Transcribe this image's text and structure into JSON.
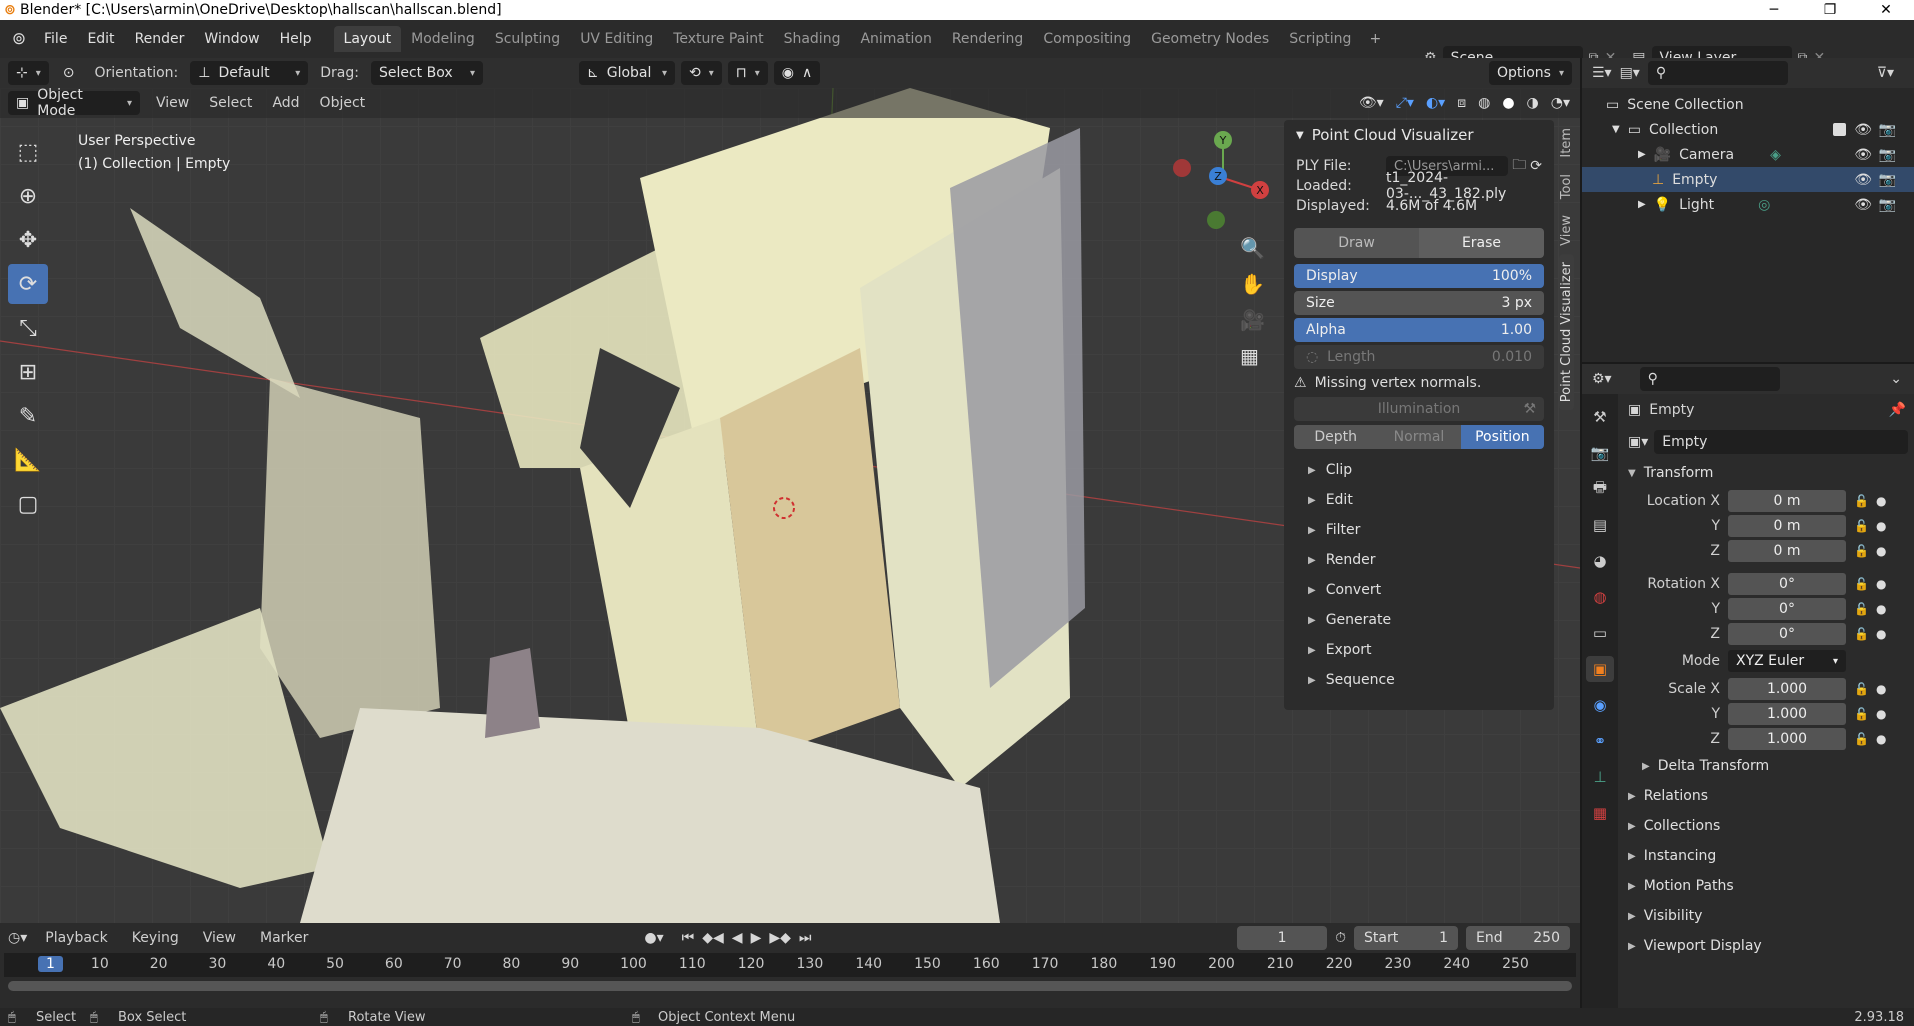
{
  "window": {
    "title": "Blender* [C:\\Users\\armin\\OneDrive\\Desktop\\hallscan\\hallscan.blend]",
    "logo": "blender-logo",
    "minimize": "─",
    "maximize": "❐",
    "close": "✕"
  },
  "menu": [
    "File",
    "Edit",
    "Render",
    "Window",
    "Help"
  ],
  "workspace_tabs": [
    "Layout",
    "Modeling",
    "Sculpting",
    "UV Editing",
    "Texture Paint",
    "Shading",
    "Animation",
    "Rendering",
    "Compositing",
    "Geometry Nodes",
    "Scripting"
  ],
  "active_tab": "Layout",
  "scene": {
    "name": "Scene",
    "view_layer": "View Layer"
  },
  "tool_header": {
    "orientation_label": "Orientation:",
    "orientation_value": "Default",
    "drag_label": "Drag:",
    "drag_value": "Select Box",
    "transform_orientation": "Global",
    "options": "Options"
  },
  "viewport_header": {
    "mode": "Object Mode",
    "menus": [
      "View",
      "Select",
      "Add",
      "Object"
    ]
  },
  "viewport": {
    "perspective": "User Perspective",
    "collection_info": "(1) Collection | Empty",
    "gizmo_axes": {
      "y": "Y",
      "x": "X",
      "z": "Z"
    }
  },
  "npanel": {
    "title": "Point Cloud Visualizer",
    "ply_file_label": "PLY File:",
    "ply_file_value": "C:\\Users\\armi...",
    "loaded_label": "Loaded:",
    "loaded_value": "t1_2024-03-..._43_182.ply",
    "displayed_label": "Displayed:",
    "displayed_value": "4.6M of 4.6M",
    "draw": "Draw",
    "erase": "Erase",
    "display_label": "Display",
    "display_value": "100%",
    "size_label": "Size",
    "size_value": "3 px",
    "alpha_label": "Alpha",
    "alpha_value": "1.00",
    "length_label": "Length",
    "length_value": "0.010",
    "warning": "Missing vertex normals.",
    "illumination": "Illumination",
    "modes": [
      "Depth",
      "Normal",
      "Position"
    ],
    "subpanels": [
      "Clip",
      "Edit",
      "Filter",
      "Render",
      "Convert",
      "Generate",
      "Export",
      "Sequence"
    ]
  },
  "side_tabs": [
    "Item",
    "Tool",
    "View",
    "Point Cloud Visualizer"
  ],
  "outliner": {
    "root": "Scene Collection",
    "collection": "Collection",
    "items": [
      "Camera",
      "Empty",
      "Light"
    ]
  },
  "properties": {
    "object_name": "Empty",
    "data_name": "Empty",
    "transform_title": "Transform",
    "location_label": "Location X",
    "location": [
      "0 m",
      "0 m",
      "0 m"
    ],
    "rotation_label": "Rotation X",
    "rotation": [
      "0°",
      "0°",
      "0°"
    ],
    "mode_label": "Mode",
    "mode_value": "XYZ Euler",
    "scale_label": "Scale X",
    "scale": [
      "1.000",
      "1.000",
      "1.000"
    ],
    "axis_y": "Y",
    "axis_z": "Z",
    "delta": "Delta Transform",
    "sections": [
      "Relations",
      "Collections",
      "Instancing",
      "Motion Paths",
      "Visibility",
      "Viewport Display"
    ]
  },
  "timeline": {
    "menus": [
      "Playback",
      "Keying",
      "View",
      "Marker"
    ],
    "current_frame": "1",
    "start_label": "Start",
    "start": "1",
    "end_label": "End",
    "end": "250",
    "ruler": [
      "1",
      "10",
      "20",
      "30",
      "40",
      "50",
      "60",
      "70",
      "80",
      "90",
      "100",
      "110",
      "120",
      "130",
      "140",
      "150",
      "160",
      "170",
      "180",
      "190",
      "200",
      "210",
      "220",
      "230",
      "240",
      "250"
    ]
  },
  "status": {
    "select": "Select",
    "box_select": "Box Select",
    "rotate": "Rotate View",
    "context": "Object Context Menu",
    "version": "2.93.18"
  }
}
